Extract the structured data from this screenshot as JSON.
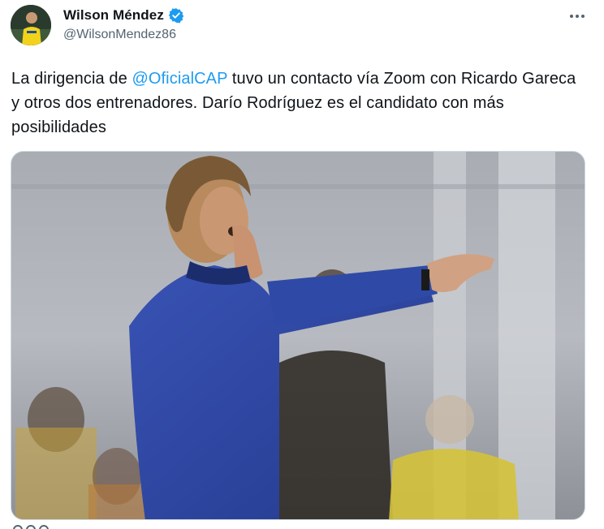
{
  "tweet": {
    "author": {
      "name": "Wilson Méndez",
      "handle": "@WilsonMendez86",
      "verified": true
    },
    "text_parts": {
      "before": "La dirigencia de ",
      "mention": "@OficialCAP",
      "after": " tuvo un contacto vía Zoom con Ricardo Gareca y otros dos entrenadores. Darío Rodríguez es el candidato con más posibilidades"
    },
    "media": {
      "description_icon": "photo-of-coach-gesturing"
    }
  },
  "colors": {
    "accent": "#1d9bf0",
    "text": "#0f1419",
    "secondary": "#536471"
  },
  "icons": {
    "verified": "verified-badge-icon",
    "more": "more-options-icon"
  }
}
